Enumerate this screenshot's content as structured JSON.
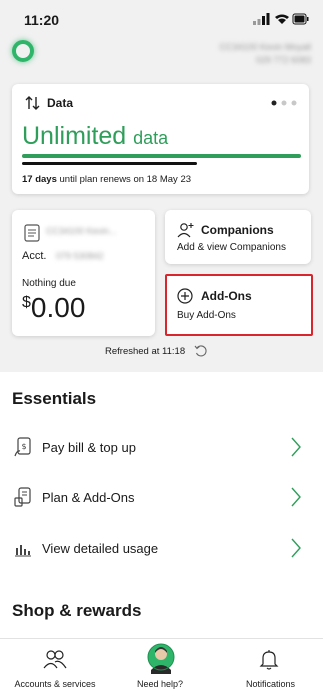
{
  "status_bar": {
    "time": "11:20"
  },
  "header": {
    "account_name": "CC34100 Kevin Moyall",
    "phone": "029 772 6083"
  },
  "data_card": {
    "title": "Data",
    "headline": "Unlimited",
    "headline_suffix": "data",
    "renew_days": "17 days",
    "renew_text": "until plan renews on 18 May 23",
    "page_dots": 3,
    "active_dot": 1
  },
  "account_card": {
    "name": "CC34100 Kevin...",
    "acct_label": "Acct.",
    "acct_number": "079 530842",
    "due_label": "Nothing due",
    "currency": "$",
    "amount": "0.00"
  },
  "companions": {
    "title": "Companions",
    "subtitle": "Add & view Companions"
  },
  "addons": {
    "title": "Add-Ons",
    "subtitle": "Buy Add-Ons",
    "highlight_color": "#d9252c"
  },
  "refreshed": "Refreshed at 11:18",
  "essentials": {
    "title": "Essentials",
    "items": [
      {
        "label": "Pay bill & top up",
        "icon": "bill-icon"
      },
      {
        "label": "Plan & Add-Ons",
        "icon": "plan-icon"
      },
      {
        "label": "View detailed usage",
        "icon": "usage-chart-icon"
      }
    ]
  },
  "shop": {
    "title": "Shop & rewards"
  },
  "nav": {
    "items": [
      {
        "label": "Accounts & services",
        "icon": "people-icon"
      },
      {
        "label": "Need help?",
        "icon": "help-avatar-icon"
      },
      {
        "label": "Notifications",
        "icon": "bell-icon"
      }
    ]
  },
  "colors": {
    "brand_green": "#2f9e5a",
    "accent_green": "#2fb56a"
  }
}
